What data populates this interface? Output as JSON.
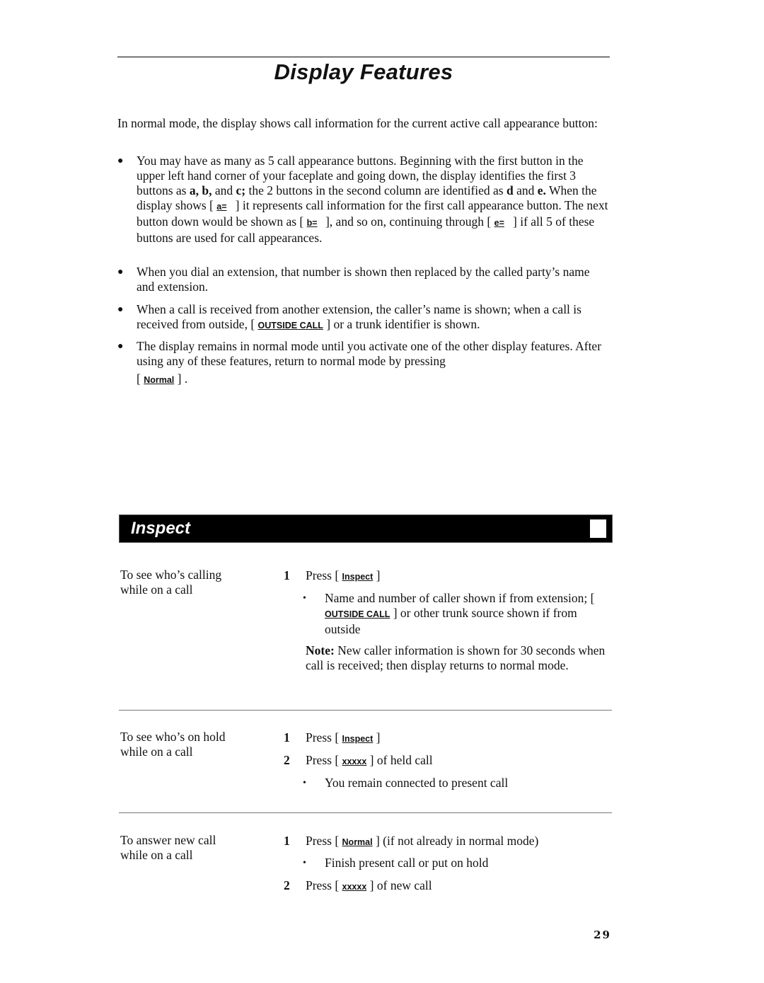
{
  "page": {
    "title": "Display Features",
    "intro": "In normal mode, the display shows call information for the current active call appearance button:",
    "bullets": {
      "b1": {
        "t1": "You may have as many as 5 call appearance buttons. Beginning with the first button in the upper left hand corner of your faceplate and going down, the display identifies the first 3 buttons as ",
        "bold1": "a, b,",
        "t2": " and ",
        "bold2": "c;",
        "t3": " the 2 buttons in the second column are identified as ",
        "bold3": "d",
        "t4": " and ",
        "bold4": "e.",
        "t5": " When the display shows [ ",
        "key1": "a=",
        "t6": " ] it represents call information for the first call appearance button. The next button down would be shown as [ ",
        "key2": "b=",
        "t7": " ], and so on, continuing through [ ",
        "key3": "e=",
        "t8": " ] if all 5 of these buttons are used for call appearances."
      },
      "b2": "When you dial an extension, that number is shown then replaced by the called party’s name and extension.",
      "b3": {
        "t1": "When a call is received from another extension, the caller’s name is shown; when a call is received from outside, [ ",
        "key": "OUTSIDE CALL",
        "t2": " ] or a trunk identifier is shown."
      },
      "b4": {
        "t1": "The display remains in normal mode until you activate one of the other display features. After using any of these features, return to normal mode by pressing",
        "open": "[ ",
        "key": "Normal",
        "close": " ] ."
      }
    },
    "page_number": "29"
  },
  "section": {
    "title": "Inspect",
    "tasks": [
      {
        "label_line1": "To see who’s calling",
        "label_line2": "while on a call",
        "step1": {
          "num": "1",
          "pre": "Press [ ",
          "key": "Inspect",
          "post": " ]"
        },
        "sub1": {
          "pre": "Name and number of caller shown if from extension; [ ",
          "key": "OUTSIDE CALL",
          "post": " ] or other trunk source shown if from outside"
        },
        "note": {
          "label": "Note:",
          "text": " New caller information is shown for 30 seconds when call is received; then display returns to normal  mode."
        }
      },
      {
        "label_line1": "To see who’s on hold",
        "label_line2": "while on a call",
        "step1": {
          "num": "1",
          "pre": "Press [ ",
          "key": "Inspect",
          "post": " ]"
        },
        "step2": {
          "num": "2",
          "pre": "Press [ ",
          "key": "xxxxx",
          "post": " ] of held call"
        },
        "sub1": {
          "text": "You remain connected to present call"
        }
      },
      {
        "label_line1": "To answer new call",
        "label_line2": "while on a call",
        "step1": {
          "num": "1",
          "pre": "Press [ ",
          "key": "Normal",
          "post": " ] (if not already in normal mode)"
        },
        "sub1": {
          "text": "Finish present call or put on hold"
        },
        "step2": {
          "num": "2",
          "pre": "Press [ ",
          "key": "xxxxx",
          "post": " ] of new call"
        }
      }
    ]
  }
}
